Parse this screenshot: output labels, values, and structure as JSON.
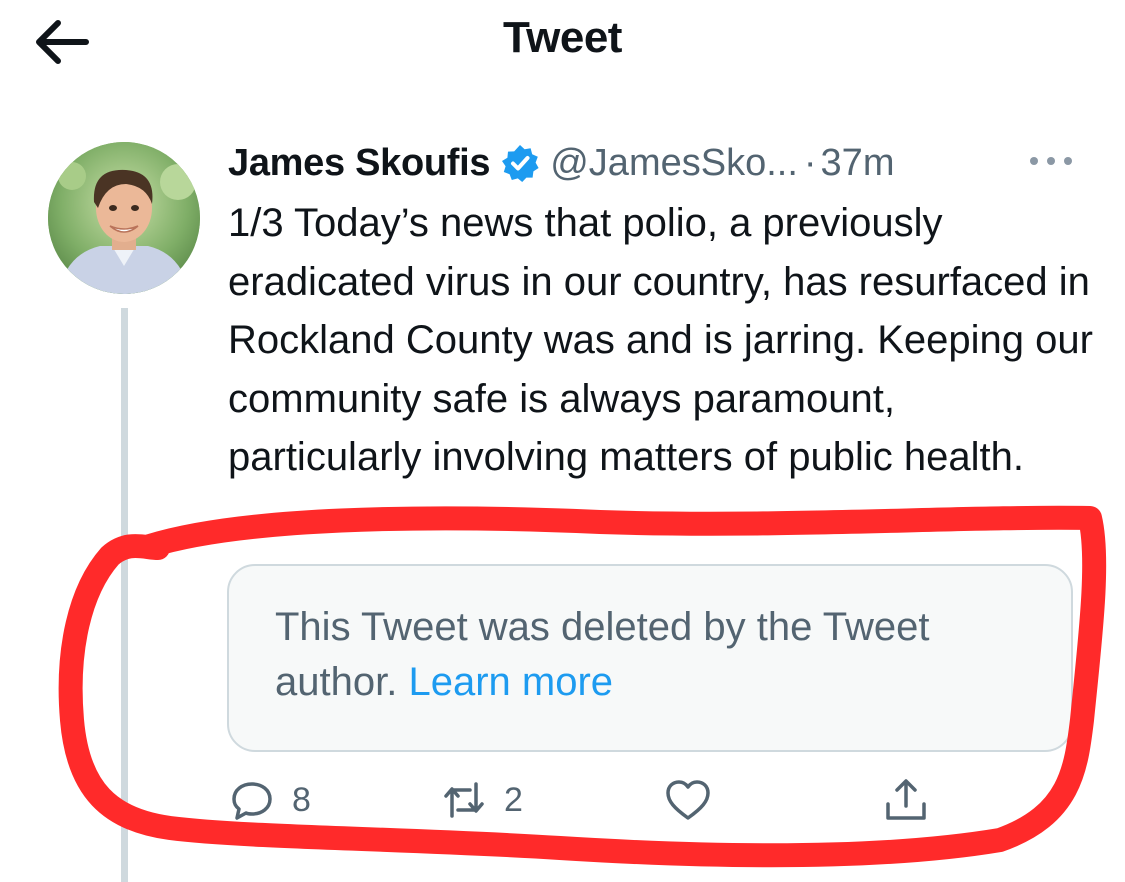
{
  "header": {
    "title": "Tweet",
    "back_icon": "arrow-left-icon"
  },
  "tweet": {
    "author": {
      "name": "James Skoufis",
      "handle": "@JamesSko...",
      "verified": true,
      "verified_color": "#1d9bf0"
    },
    "separator": "·",
    "time": "37m",
    "more_icon": "ellipsis-icon",
    "text": "1/3 Today’s news that polio, a previously eradicated virus in our country, has resurfaced in Rockland County was and is jarring. Keeping our community safe is always paramount, particularly involving matters of public health."
  },
  "quote": {
    "message": "This Tweet was deleted by the Tweet author.",
    "link_label": "Learn more",
    "link_color": "#1d9bf0"
  },
  "actions": {
    "reply": {
      "icon": "reply-icon",
      "count": "8"
    },
    "retweet": {
      "icon": "retweet-icon",
      "count": "2"
    },
    "like": {
      "icon": "heart-icon",
      "count": ""
    },
    "share": {
      "icon": "share-icon"
    }
  },
  "annotation": {
    "color": "#ff2a2a",
    "shape": "hand-drawn outline"
  }
}
